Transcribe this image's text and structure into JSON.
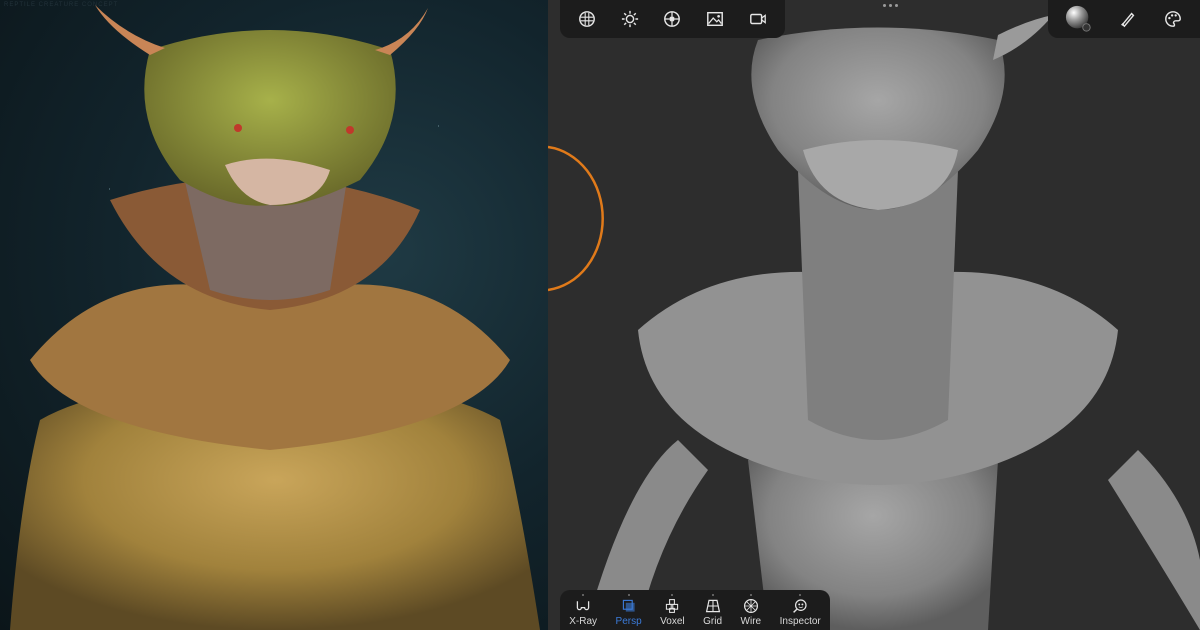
{
  "left_panel": {
    "description": "Rendered colored creature bust",
    "watermark": "REPTILE CREATURE CONCEPT"
  },
  "viewport": {
    "description": "Gray sculpt viewport of creature bust",
    "more_menu_icon": "ellipsis-icon",
    "cursor_ring_color": "#e07a1a"
  },
  "top_toolbar": {
    "items": [
      {
        "name": "scene-icon",
        "label": "Scene"
      },
      {
        "name": "lighting-icon",
        "label": "Lighting"
      },
      {
        "name": "shading-icon",
        "label": "Shading"
      },
      {
        "name": "background-icon",
        "label": "Background"
      },
      {
        "name": "camera-icon",
        "label": "Camera"
      }
    ]
  },
  "right_toolbar": {
    "items": [
      {
        "name": "material-icon",
        "label": "Material"
      },
      {
        "name": "brush-icon",
        "label": "Brush"
      },
      {
        "name": "palette-icon",
        "label": "Palette"
      }
    ]
  },
  "bottom_toolbar": {
    "items": [
      {
        "name": "xray-icon",
        "label": "X-Ray",
        "active": false
      },
      {
        "name": "persp-icon",
        "label": "Persp",
        "active": true
      },
      {
        "name": "voxel-icon",
        "label": "Voxel",
        "active": false
      },
      {
        "name": "grid-icon",
        "label": "Grid",
        "active": false
      },
      {
        "name": "wire-icon",
        "label": "Wire",
        "active": false
      },
      {
        "name": "inspector-icon",
        "label": "Inspector",
        "active": false
      }
    ],
    "active_color": "#3b7bd9"
  }
}
